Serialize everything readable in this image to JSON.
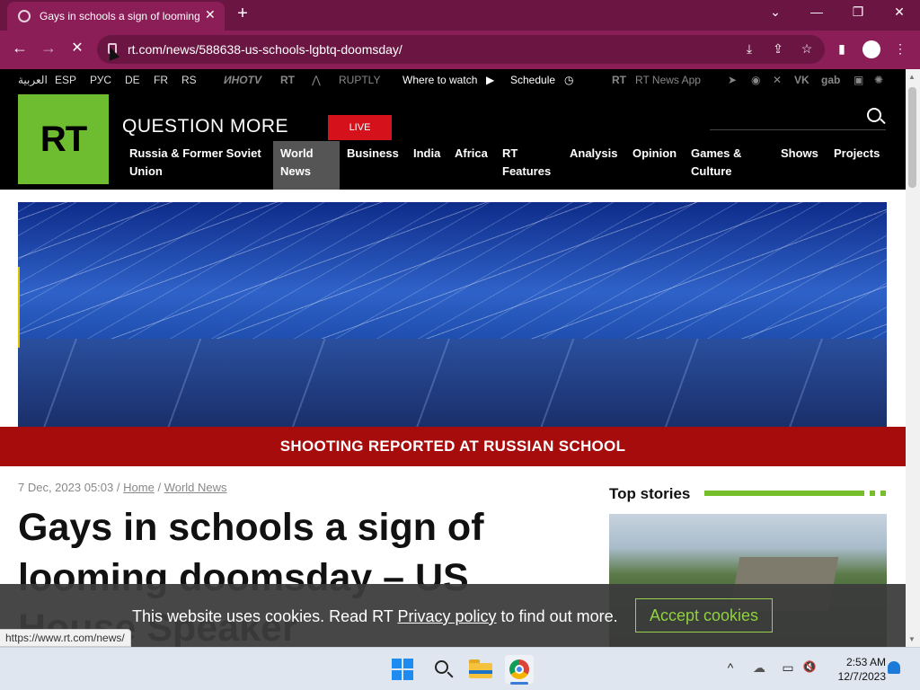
{
  "browser": {
    "tab_title": "Gays in schools a sign of looming doomsday – US House Speaker",
    "tab_close": "✕",
    "new_tab": "+",
    "url": "rt.com/news/588638-us-schools-lgbtq-doomsday/",
    "status_url": "https://www.rt.com/news/",
    "window_controls": {
      "dropdown": "⌄",
      "minimize": "—",
      "restore": "❐",
      "close": "✕"
    },
    "nav_icons": {
      "back": "←",
      "forward": "→",
      "reload": "✕"
    },
    "toolbar_icons": {
      "install": "⤓",
      "share": "⇪",
      "bookmark": "☆",
      "sidepanel": "▮",
      "menu": "⋮"
    }
  },
  "site": {
    "languages": [
      "العربية",
      "ESP",
      "РУС",
      "DE",
      "FR",
      "RS"
    ],
    "topbar_brands": [
      "ИНОTV",
      "RT",
      "RUPTLY"
    ],
    "where_to_watch": "Where to watch",
    "schedule": "Schedule",
    "news_app": "RT News App",
    "social_icons": [
      "telegram-icon",
      "rss-icon",
      "x-icon",
      "vk-icon",
      "gab-icon",
      "rumble-icon",
      "odysee-icon"
    ],
    "gab": "gab",
    "logo": "RT",
    "tagline": "QUESTION MORE",
    "live": "LIVE",
    "nav": [
      "Russia & Former Soviet Union",
      "World News",
      "Business",
      "India",
      "Africa",
      "RT Features",
      "Analysis",
      "Opinion",
      "Games & Culture",
      "Shows",
      "Projects"
    ],
    "breaking": "SHOOTING REPORTED AT RUSSIAN SCHOOL",
    "article": {
      "date": "7 Dec, 2023 05:03",
      "sep": "/",
      "crumbs": [
        "Home",
        "World News"
      ],
      "headline": "Gays in schools a sign of looming doomsday – US House Speaker"
    },
    "top_stories": "Top stories",
    "cookie": {
      "prefix": "This website uses cookies. Read RT",
      "link": "Privacy policy",
      "suffix": "to find out more.",
      "accept": "Accept cookies"
    }
  },
  "taskbar": {
    "time": "2:53 AM",
    "date": "12/7/2023",
    "tray": {
      "chevron": "^",
      "cloud": "☁",
      "display": "▭",
      "volume": "🔇"
    }
  },
  "colors": {
    "tab_bg": "#8b1d57",
    "strip_bg": "#6b1542",
    "rt_green": "#6ebc2f",
    "live_red": "#d5121b",
    "breaking_red": "#a60c0c",
    "accept_green": "#8fd13f"
  }
}
